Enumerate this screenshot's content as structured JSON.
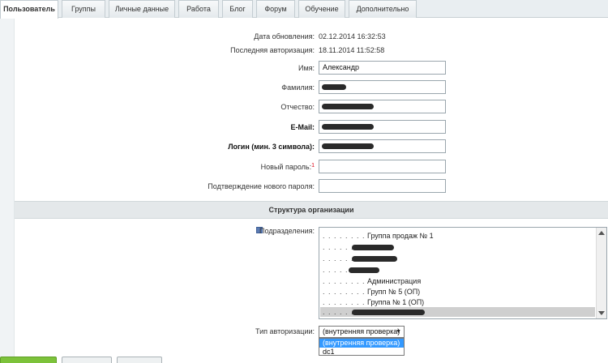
{
  "tabs": [
    {
      "label": "Пользователь",
      "active": true
    },
    {
      "label": "Группы"
    },
    {
      "label": "Личные данные"
    },
    {
      "label": "Работа"
    },
    {
      "label": "Блог"
    },
    {
      "label": "Форум"
    },
    {
      "label": "Обучение"
    },
    {
      "label": "Дополнительно"
    }
  ],
  "info": {
    "updated_label": "Дата обновления:",
    "updated_value": "02.12.2014 16:32:53",
    "lastauth_label": "Последняя авторизация:",
    "lastauth_value": "18.11.2014 11:52:58"
  },
  "form": {
    "name_label": "Имя:",
    "name_value": "Александр",
    "lastname_label": "Фамилия:",
    "patronymic_label": "Отчество:",
    "email_label": "E-Mail:",
    "login_label": "Логин (мин. 3 символа):",
    "newpass_label": "Новый пароль:",
    "newpass_required_mark": "1",
    "confirmpass_label": "Подтверждение нового пароля:"
  },
  "org": {
    "section_title": "Структура организации",
    "departments_label": "Подразделения:",
    "departments": [
      {
        "dots": ". . . . . . . .",
        "name": "Группа продаж № 1"
      },
      {
        "dots": ". . . . . . . .",
        "name": ""
      },
      {
        "dots": ". . . . . . . .",
        "name": ""
      },
      {
        "dots": ". . . . . . . .",
        "name": ""
      },
      {
        "dots": ". . . . . . . .",
        "name": "Администрация"
      },
      {
        "dots": ". . . . . . . .",
        "name": "Групп № 5 (ОП)"
      },
      {
        "dots": ". . . . . . . .",
        "name": "Группа № 1 (ОП)"
      },
      {
        "dots": ". . . . . . . .",
        "name": ""
      }
    ]
  },
  "auth": {
    "label": "Тип авторизации:",
    "selected": "(внутренняя проверка)",
    "arrow": "▼",
    "options": [
      "(внутренняя проверка)",
      "dc1"
    ]
  }
}
